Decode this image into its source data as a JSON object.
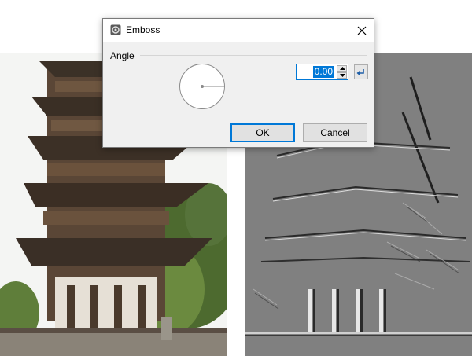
{
  "dialog": {
    "title": "Emboss",
    "group_label": "Angle",
    "angle_value": "0.00",
    "ok_label": "OK",
    "cancel_label": "Cancel"
  },
  "icons": {
    "app": "emboss-app-icon",
    "close": "close-icon",
    "reset": "reset-icon",
    "spin_up": "spin-up-icon",
    "spin_down": "spin-down-icon"
  },
  "colors": {
    "accent": "#0078d7",
    "dialog_bg": "#f0f0f0",
    "emboss_gray": "#808080"
  }
}
